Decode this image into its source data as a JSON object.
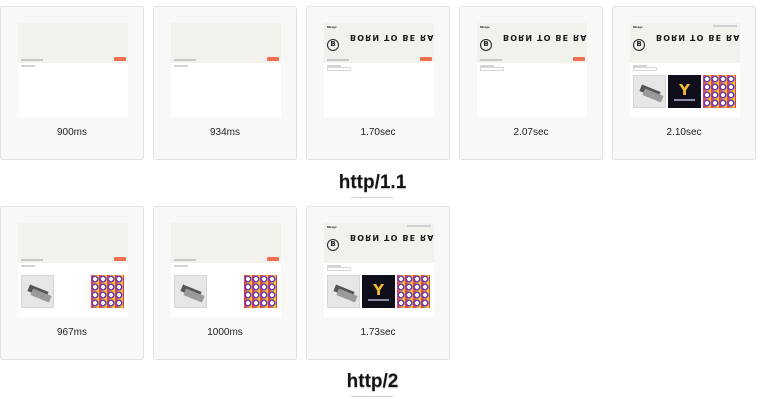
{
  "page": {
    "icon": "webpage-filmstrip-frame",
    "colors": {
      "accent_button": "#f06e52",
      "hero_background": "#f2f1ec",
      "card_background": "#f8f8f7"
    },
    "frame_texts": {
      "logo_text": "Mirage",
      "brand_mark": "B",
      "headline": "BORN TO BE RAD",
      "brand_y": "Y"
    }
  },
  "http1": {
    "section_label": "http/1.1",
    "frames": [
      {
        "time": "900ms"
      },
      {
        "time": "934ms"
      },
      {
        "time": "1.70sec"
      },
      {
        "time": "2.07sec"
      },
      {
        "time": "2.10sec"
      }
    ]
  },
  "http2": {
    "section_label": "http/2",
    "frames": [
      {
        "time": "967ms"
      },
      {
        "time": "1000ms"
      },
      {
        "time": "1.73sec"
      }
    ]
  }
}
